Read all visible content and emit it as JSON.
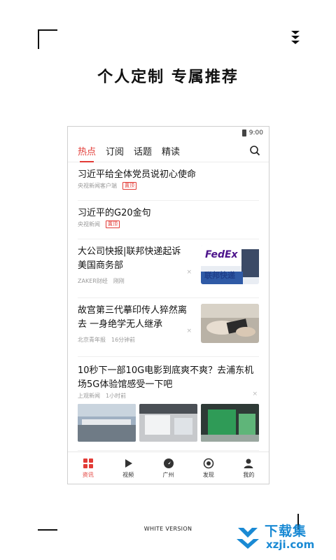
{
  "headline": "个人定制  专属推荐",
  "status_bar": {
    "time": "9:00"
  },
  "tabs": [
    {
      "label": "热点",
      "active": true
    },
    {
      "label": "订阅",
      "active": false
    },
    {
      "label": "话题",
      "active": false
    },
    {
      "label": "精读",
      "active": false
    }
  ],
  "feed": {
    "item1": {
      "title": "习近平给全体党员说初心使命",
      "source": "央视新闻客户端",
      "tag": "置顶"
    },
    "item2": {
      "title": "习近平的G20金句",
      "source": "央视新闻",
      "tag": "置顶"
    },
    "item3": {
      "title": "大公司快报|联邦快递起诉美国商务部",
      "source": "ZAKER财经",
      "time": "刚刚",
      "thumb_text": "FedEx",
      "thumb_sub": "联邦快递"
    },
    "item4": {
      "title": "故宫第三代摹印传人猝然离去 一身绝学无人继承",
      "source": "北京青年报",
      "time": "16分钟前"
    },
    "item5": {
      "title": "10秒下一部10G电影到底爽不爽？去浦东机场5G体验馆感受一下吧",
      "source": "上观新闻",
      "time": "1小时前"
    }
  },
  "close_glyph": "×",
  "nav": [
    {
      "label": "资讯",
      "icon": "grid-icon",
      "active": true
    },
    {
      "label": "视频",
      "icon": "play-icon",
      "active": false
    },
    {
      "label": "广州",
      "icon": "compass-icon",
      "active": false
    },
    {
      "label": "发现",
      "icon": "target-icon",
      "active": false
    },
    {
      "label": "我的",
      "icon": "user-icon",
      "active": false
    }
  ],
  "version_label": "WHITE VERSION",
  "watermark": {
    "cn": "下载集",
    "en": "xzji.com"
  },
  "colors": {
    "accent": "#e23b36",
    "watermark": "#1a8ad4"
  }
}
